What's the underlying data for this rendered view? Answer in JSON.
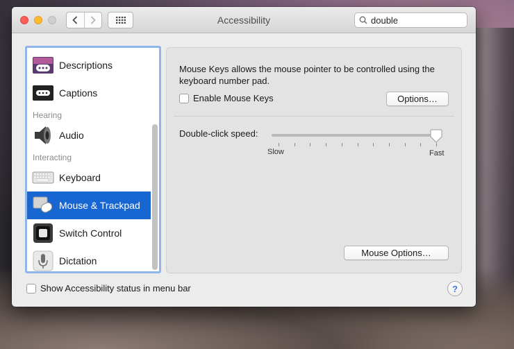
{
  "window": {
    "title": "Accessibility"
  },
  "search": {
    "value": "double"
  },
  "sidebar": {
    "items": [
      {
        "label": "Descriptions",
        "icon": "descriptions-icon"
      },
      {
        "label": "Captions",
        "icon": "captions-icon"
      },
      {
        "label": "Audio",
        "icon": "speaker-icon"
      },
      {
        "label": "Keyboard",
        "icon": "keyboard-icon"
      },
      {
        "label": "Mouse & Trackpad",
        "icon": "mouse-trackpad-icon",
        "selected": true
      },
      {
        "label": "Switch Control",
        "icon": "switch-control-icon"
      },
      {
        "label": "Dictation",
        "icon": "microphone-icon"
      }
    ],
    "groups": {
      "hearing": "Hearing",
      "interacting": "Interacting"
    }
  },
  "main": {
    "description": "Mouse Keys allows the mouse pointer to be controlled using the keyboard number pad.",
    "enable_mouse_keys": {
      "label": "Enable Mouse Keys",
      "checked": false
    },
    "options_button": "Options…",
    "double_click_speed": {
      "label": "Double-click speed:",
      "min_label": "Slow",
      "max_label": "Fast",
      "value_fraction": 1.0,
      "tick_count": 11
    },
    "mouse_options_button": "Mouse Options…"
  },
  "footer": {
    "show_status_label": "Show Accessibility status in menu bar",
    "show_status_checked": false,
    "help_label": "?"
  },
  "colors": {
    "selection": "#1766d1",
    "sidebar_focus_ring": "#8fb6ea"
  }
}
